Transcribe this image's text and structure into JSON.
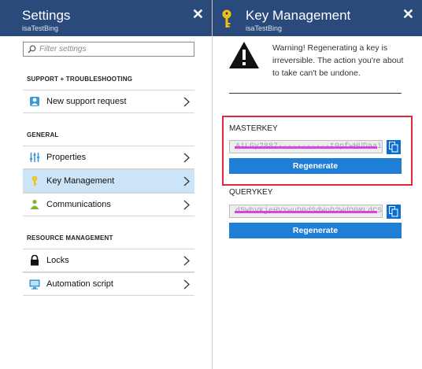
{
  "settings": {
    "title": "Settings",
    "subtitle": "isaTestBing",
    "close_glyph": "✕",
    "filter_placeholder": "Filter settings",
    "sections": [
      {
        "heading": "SUPPORT + TROUBLESHOOTING",
        "items": [
          {
            "label": "New support request",
            "icon": "support-person-icon"
          }
        ]
      },
      {
        "heading": "GENERAL",
        "items": [
          {
            "label": "Properties",
            "icon": "properties-sliders-icon"
          },
          {
            "label": "Key Management",
            "icon": "key-icon",
            "active": true
          },
          {
            "label": "Communications",
            "icon": "communications-people-icon"
          }
        ]
      },
      {
        "heading": "RESOURCE MANAGEMENT",
        "items": [
          {
            "label": "Locks",
            "icon": "lock-icon"
          },
          {
            "label": "Automation script",
            "icon": "automation-script-icon"
          }
        ]
      }
    ]
  },
  "key_management": {
    "title": "Key Management",
    "subtitle": "isaTestBing",
    "close_glyph": "✕",
    "warning": "Warning! Regenerating a key is irreversible. The action you're about to take can't be undone.",
    "masterkey": {
      "label": "MASTERKEY",
      "value": "AiLGy2887···········t9pfwHUDaaiJdwSrWW",
      "regen_label": "Regenerate"
    },
    "querykey": {
      "label": "QUERYKEY",
      "value": "d5WhVKjeHVYwuD0dSdWoD2WdD0MLdCS3DJ2",
      "regen_label": "Regenerate"
    }
  },
  "colors": {
    "header": "#2b4a7c",
    "accent": "#1f7fd6",
    "highlight": "#e0283a",
    "active_row": "#cce4f7"
  }
}
